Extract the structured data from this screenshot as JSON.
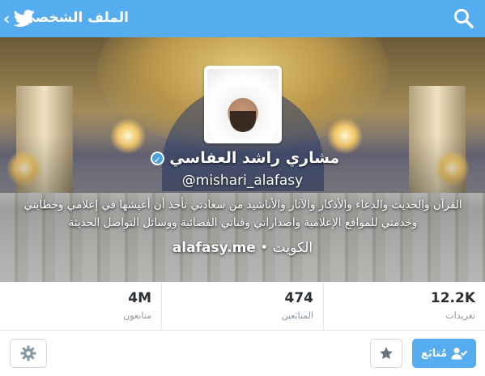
{
  "topbar": {
    "title": "الملف الشخصي",
    "back_icon": "chevron-left-icon",
    "bird_icon": "twitter-bird-icon",
    "search_icon": "search-icon",
    "color": "#55acee"
  },
  "profile": {
    "name": "مشاري راشد العفاسي",
    "handle": "@mishari_alafasy",
    "bio_line1": "القرآن والحديث والدعاء والأذكار والآثار والأناشيد من سعادتي تأخذ أن أعيشها في إعلامي وخطابتي",
    "bio_line2": "وخدمتي للمواقع الإعلامية واصداراتي وقناتي الفضائية ووسائل التواصل الحديثة",
    "location": "الكويت",
    "separator": "•",
    "website": "alafasy.me"
  },
  "stats": [
    {
      "value": "4M",
      "label": "متابعون"
    },
    {
      "value": "474",
      "label": "المتابَعين"
    },
    {
      "value": "12.2K",
      "label": "تغريدات"
    }
  ],
  "actions": {
    "follow_label": "مُتابَع",
    "follow_icon": "person-check-icon",
    "favorite_icon": "star-icon",
    "settings_icon": "gear-icon"
  }
}
